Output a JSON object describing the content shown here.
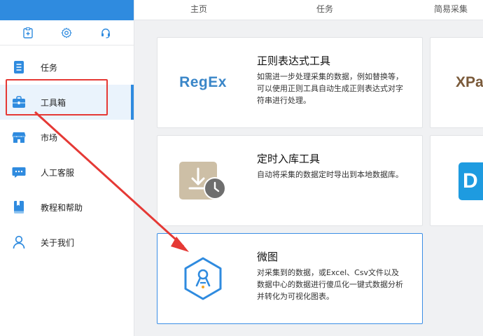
{
  "sidebar": {
    "tools": [
      {
        "icon": "clipboard-add-icon"
      },
      {
        "icon": "gear-icon"
      },
      {
        "icon": "headset-icon"
      }
    ],
    "items": [
      {
        "label": "任务",
        "icon": "task-document-icon"
      },
      {
        "label": "工具箱",
        "icon": "toolbox-icon"
      },
      {
        "label": "市场",
        "icon": "market-store-icon"
      },
      {
        "label": "人工客服",
        "icon": "chat-bubble-icon"
      },
      {
        "label": "教程和帮助",
        "icon": "book-icon"
      },
      {
        "label": "关于我们",
        "icon": "user-icon"
      }
    ],
    "active_index": 1
  },
  "tabs": [
    {
      "label": "主页"
    },
    {
      "label": "任务"
    },
    {
      "label": "简易采集"
    }
  ],
  "cards": [
    {
      "title": "正则表达式工具",
      "description": "如需进一步处理采集的数据，例如替换等，可以使用正则工具自动生成正则表达式对字符串进行处理。",
      "logo_text_a": "Reg",
      "logo_text_b": "Ex"
    },
    {
      "title": "定时入库工具",
      "description": "自动将采集的数据定时导出到本地数据库。",
      "icon": "download-clock-icon"
    },
    {
      "title": "微图",
      "description": "对采集到的数据，或Excel、Csv文件以及数据中心的数据进行傻瓜化一键式数据分析并转化为可视化图表。",
      "icon": "weitu-hexagon-logo-icon"
    }
  ],
  "partial_cards": [
    {
      "logo_text": "XPa"
    },
    {
      "logo_text": "D"
    }
  ],
  "colors": {
    "brand_blue": "#2f8bdf",
    "highlight_red": "#e53935",
    "selected_border": "#3a8ee6"
  }
}
